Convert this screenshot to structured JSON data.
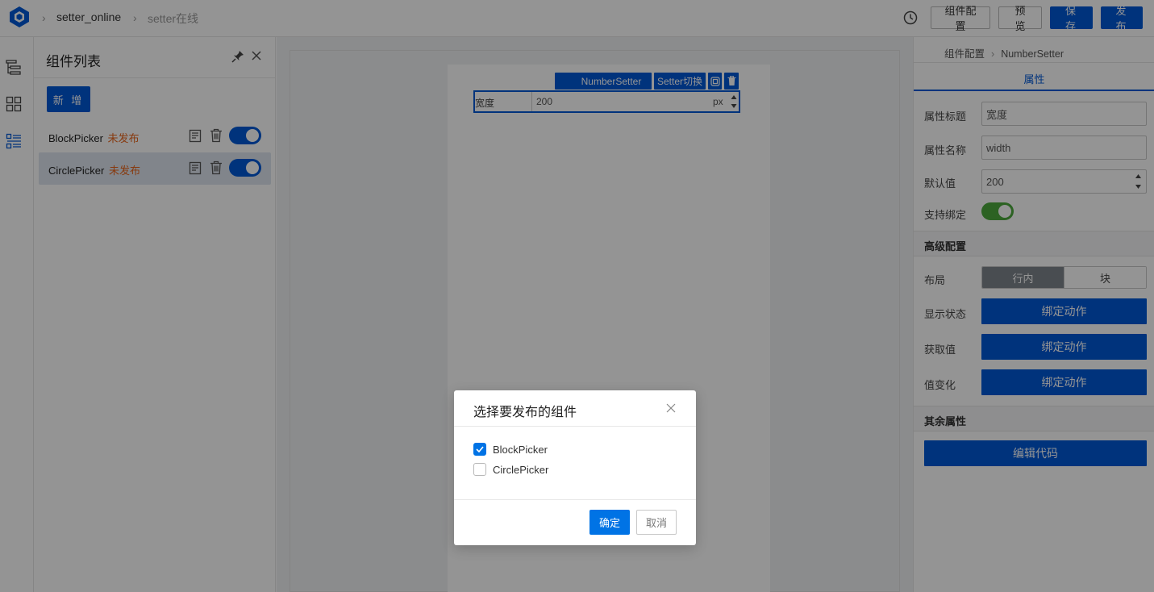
{
  "colors": {
    "primary": "#0058d6",
    "accent_orange": "#e8641a",
    "toggle_green": "#4ca93d",
    "mask": "rgba(0,0,0,0.42)"
  },
  "breadcrumb": {
    "item1": "setter_online",
    "item2": "setter在线"
  },
  "toolbar": {
    "history_icon": "clock-icon",
    "component_config_label": "组件配置",
    "preview_label": "预 览",
    "save_label": "保 存",
    "publish_label": "发 布"
  },
  "rail": {
    "icons": [
      "outline-tree-icon",
      "grid-blocks-icon",
      "component-list-icon"
    ]
  },
  "panel": {
    "title": "组件列表",
    "add_label": "新 增",
    "components": [
      {
        "name": "BlockPicker",
        "status": "未发布",
        "enabled": true
      },
      {
        "name": "CirclePicker",
        "status": "未发布",
        "enabled": true
      }
    ]
  },
  "canvas": {
    "toolbar": {
      "name": "NumberSetter",
      "switch_label": "Setter切换"
    },
    "field": {
      "label": "宽度",
      "value": "200",
      "unit": "px"
    }
  },
  "props": {
    "crumb": {
      "root": "组件配置",
      "current": "NumberSetter"
    },
    "tab": "属性",
    "title_label": "属性标题",
    "title_value": "宽度",
    "name_label": "属性名称",
    "name_value": "width",
    "default_label": "默认值",
    "default_value": "200",
    "bind_label": "支持绑定",
    "bind_enabled": true,
    "advanced_title": "高级配置",
    "layout_label": "布局",
    "layout_options": [
      "行内",
      "块"
    ],
    "layout_selected": "行内",
    "visible_label": "显示状态",
    "getvalue_label": "获取值",
    "change_label": "值变化",
    "bind_action_label": "绑定动作",
    "rest_title": "其余属性",
    "edit_code_label": "编辑代码"
  },
  "modal": {
    "title": "选择要发布的组件",
    "options": [
      {
        "label": "BlockPicker",
        "checked": true
      },
      {
        "label": "CirclePicker",
        "checked": false
      }
    ],
    "ok_label": "确定",
    "cancel_label": "取消"
  }
}
